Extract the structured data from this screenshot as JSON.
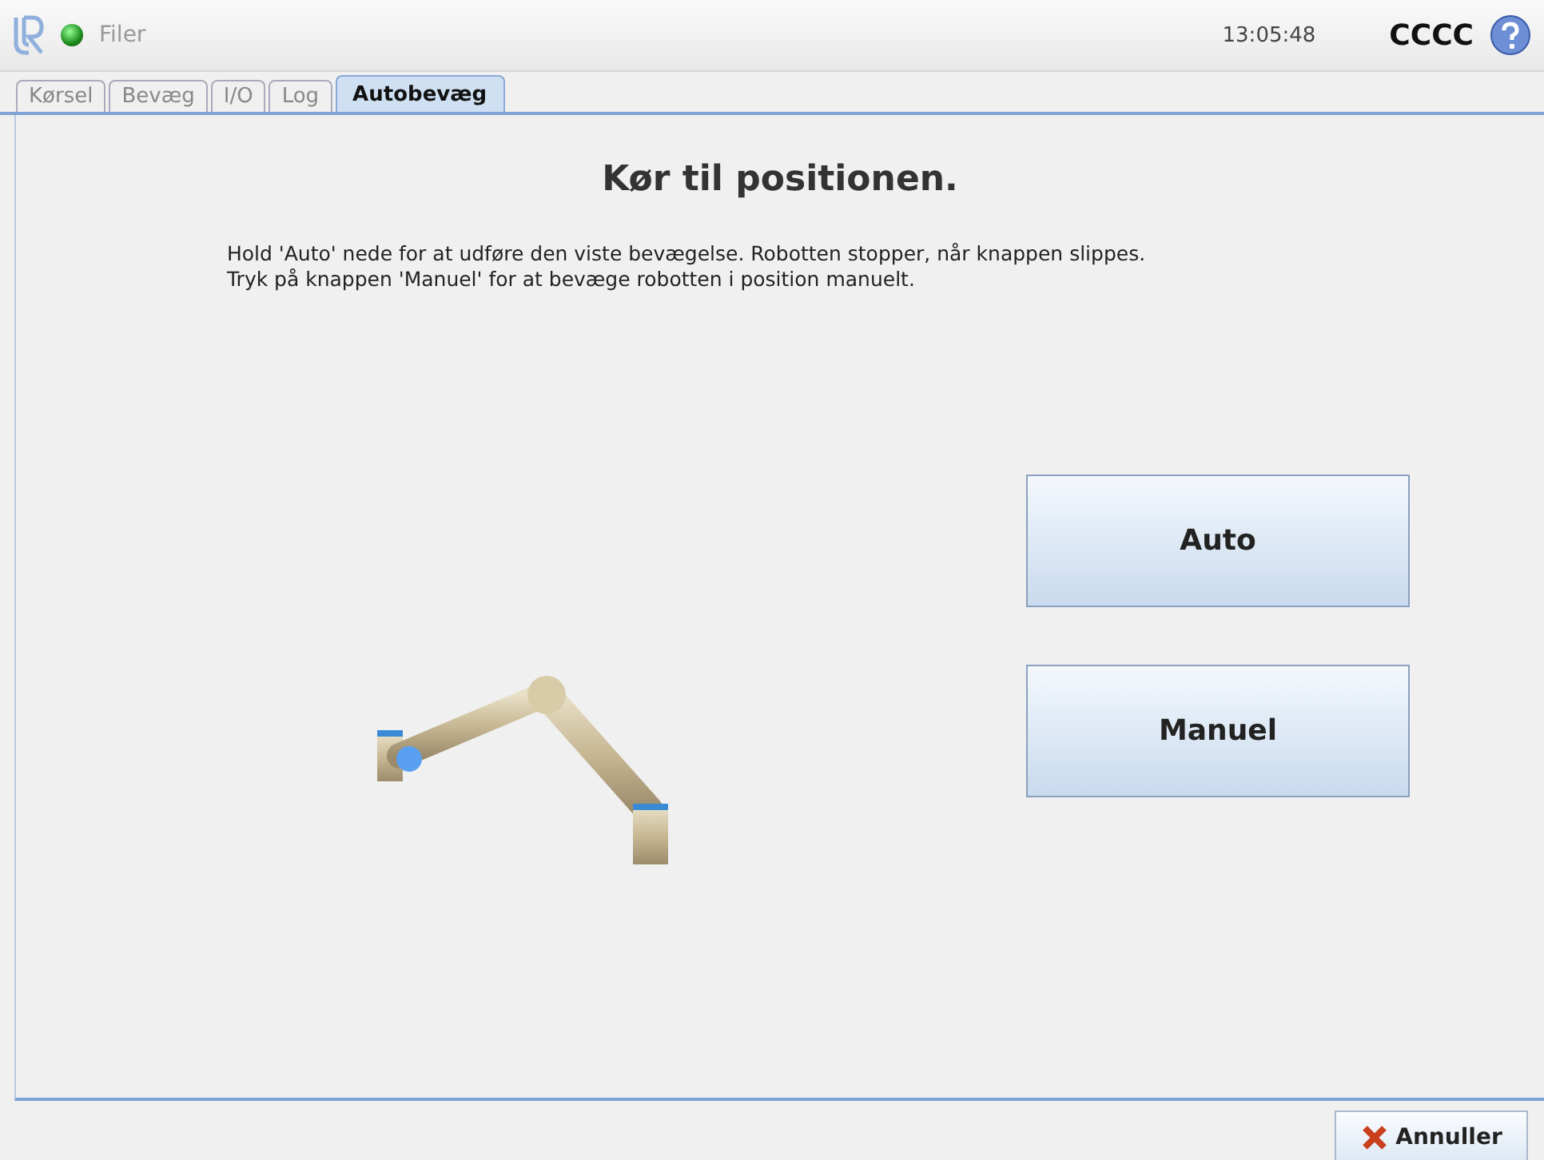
{
  "header": {
    "status_on": true,
    "menu": "Filer",
    "time": "13:05:48",
    "robot_name": "CCCC"
  },
  "tabs": [
    {
      "label": "Kørsel",
      "selected": false
    },
    {
      "label": "Bevæg",
      "selected": false
    },
    {
      "label": "I/O",
      "selected": false
    },
    {
      "label": "Log",
      "selected": false
    },
    {
      "label": "Autobevæg",
      "selected": true
    }
  ],
  "content": {
    "title": "Kør til positionen.",
    "instructions": [
      "Hold 'Auto' nede for at udføre den viste bevægelse. Robotten stopper, når knappen slippes.",
      "Tryk på knappen 'Manuel' for at bevæge robotten i position manuelt."
    ],
    "buttons": [
      "Auto",
      "Manuel"
    ]
  },
  "footer": {
    "cancel": "Annuller"
  }
}
